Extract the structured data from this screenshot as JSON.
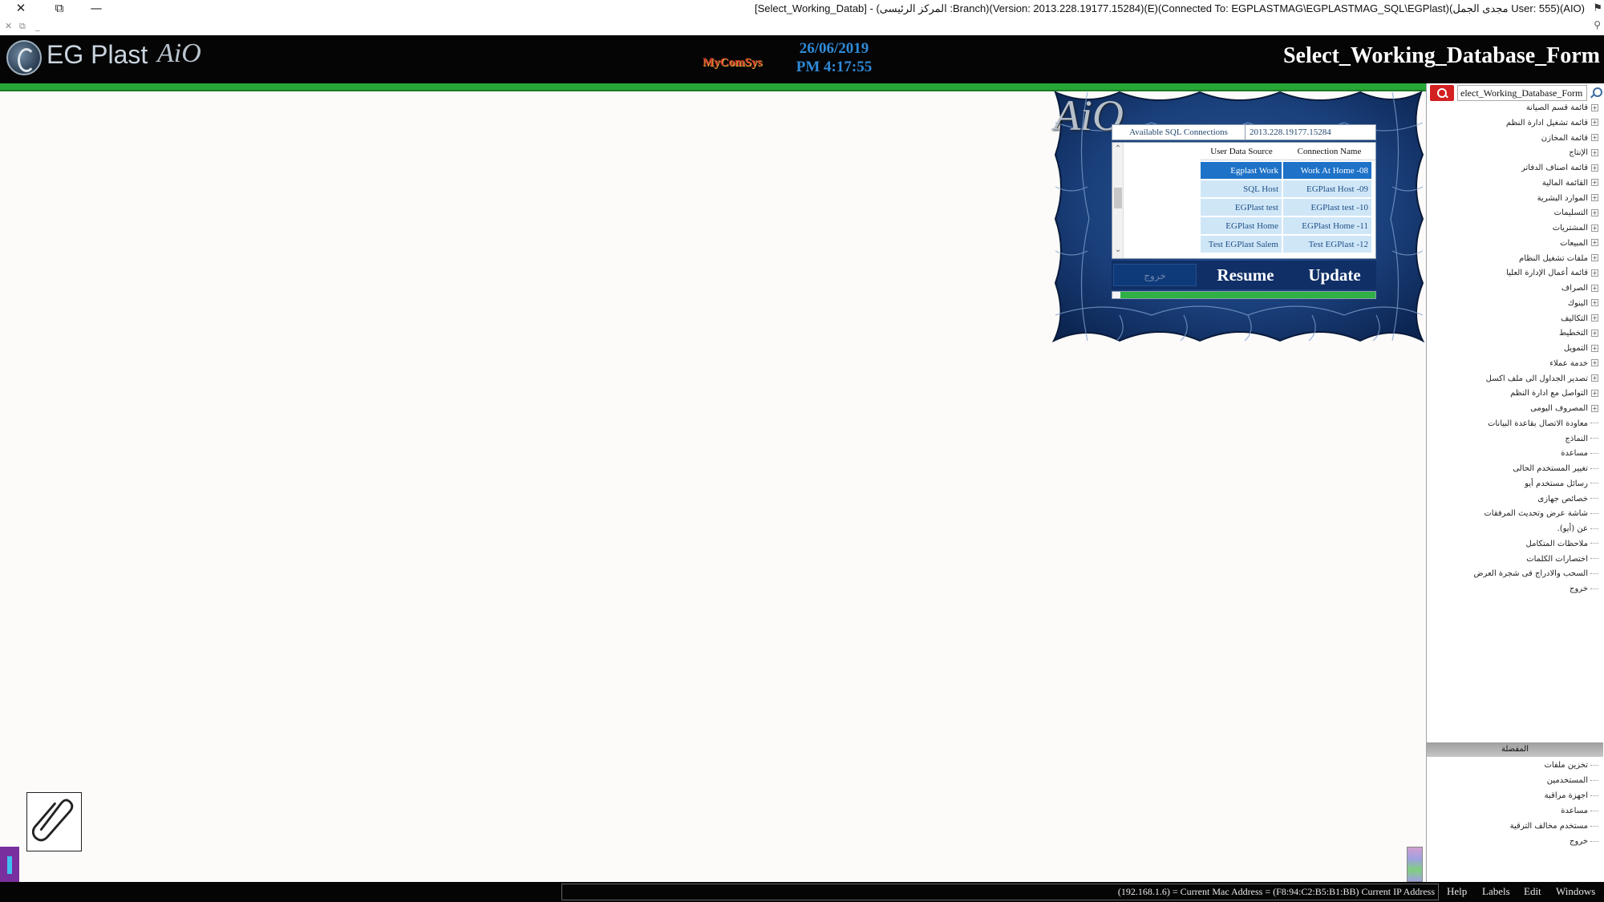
{
  "titlebar": {
    "close": "✕",
    "restore": "⧉",
    "minimize": "—",
    "small_close": "✕",
    "small_restore": "⧉",
    "small_min": "_",
    "title": "[Select_Working_Datab] - (المركز الرئيسى :Branch)(Version: 2013.228.19177.15284)(E)(Connected To: EGPLASTMAG\\EGPLASTMAG_SQL\\EGPlast)(مجدى الجمل User: 555)(AIO)"
  },
  "header": {
    "logo_text": "EG Plast",
    "logo_aio": "AiO",
    "brand": "MyComSys",
    "date": "26/06/2019",
    "time": "PM 4:17:55",
    "form_title": "Select_Working_Database_Form"
  },
  "panel": {
    "aio": "AiO",
    "conn_label": "Available SQL Connections",
    "conn_value": "2013.228.19177.15284",
    "col_source": "User Data Source",
    "col_name": "Connection Name",
    "rows": [
      {
        "source": "Egplast Work",
        "name": "Work At Home -08",
        "selected": true
      },
      {
        "source": "SQL Host",
        "name": "EGPlast Host -09",
        "selected": false
      },
      {
        "source": "EGPlast test",
        "name": "EGPlast test -10",
        "selected": false
      },
      {
        "source": "EGPlast Home",
        "name": "EGPlast Home -11",
        "selected": false
      },
      {
        "source": "Test EGPlast Salem",
        "name": "Test EGPlast -12",
        "selected": false
      }
    ],
    "exit_label": "خروج",
    "resume_label": "Resume",
    "update_label": "Update",
    "progress": 0.97
  },
  "sidebar": {
    "search_value": "elect_Working_Database_Form",
    "tree": [
      {
        "label": "قائمة قسم الصيانة",
        "expandable": true
      },
      {
        "label": "قائمة تشغيل ادارة النظم",
        "expandable": true
      },
      {
        "label": "قائمة المخازن",
        "expandable": true
      },
      {
        "label": "الإنتاج",
        "expandable": true
      },
      {
        "label": "قائمة اصناف الدفاتر",
        "expandable": true
      },
      {
        "label": "القائمة المالية",
        "expandable": true
      },
      {
        "label": "الموارد البشرية",
        "expandable": true
      },
      {
        "label": "التسليمات",
        "expandable": true
      },
      {
        "label": "المشتريات",
        "expandable": true
      },
      {
        "label": "المبيعات",
        "expandable": true
      },
      {
        "label": "ملفات تشغيل النظام",
        "expandable": true
      },
      {
        "label": "قائمة أعمال الإدارة العليا",
        "expandable": true
      },
      {
        "label": "الصراف",
        "expandable": true
      },
      {
        "label": "البنوك",
        "expandable": true
      },
      {
        "label": "التكاليف",
        "expandable": true
      },
      {
        "label": "التخطيط",
        "expandable": true
      },
      {
        "label": "التمويل",
        "expandable": true
      },
      {
        "label": "خدمة عملاء",
        "expandable": true
      },
      {
        "label": "تصدير الجداول الى ملف اكسل",
        "expandable": true
      },
      {
        "label": "التواصل مع ادارة النظم",
        "expandable": true
      },
      {
        "label": "المصروف اليومى",
        "expandable": true
      },
      {
        "label": "معاودة الاتصال بقاعدة البيانات",
        "expandable": false
      },
      {
        "label": "النماذج",
        "expandable": false
      },
      {
        "label": "مساعدة",
        "expandable": false
      },
      {
        "label": "تغيير المستخدم الحالى",
        "expandable": false
      },
      {
        "label": "رسائل مستخدم أيو",
        "expandable": false
      },
      {
        "label": "خصائص جهازى",
        "expandable": false
      },
      {
        "label": "شاشة عرض وتحديث المرفقات",
        "expandable": false
      },
      {
        "label": "عن (أيو).",
        "expandable": false
      },
      {
        "label": "ملاحظات المتكامل",
        "expandable": false
      },
      {
        "label": "اختصارات الكلمات",
        "expandable": false
      },
      {
        "label": "السحب والادراج فى شجرة العرض",
        "expandable": false
      },
      {
        "label": "خروج",
        "expandable": false
      }
    ],
    "section_title": "المفضلة",
    "tree2": [
      {
        "label": "تخزين ملفات"
      },
      {
        "label": "المستخدمين"
      },
      {
        "label": "اجهزة مراقبة"
      },
      {
        "label": "مساعدة"
      },
      {
        "label": "مستخدم مخالف الترقية"
      },
      {
        "label": "خروج"
      }
    ]
  },
  "statusbar": {
    "info": "(192.168.1.6) = Current Mac Address = (F8:94:C2:B5:B1:BB) Current IP Address",
    "menu": [
      "Help",
      "Labels",
      "Edit",
      "Windows"
    ]
  }
}
